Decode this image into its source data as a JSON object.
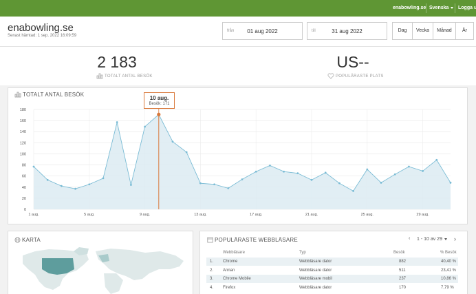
{
  "topbar": {
    "site": "enabowling.se",
    "language": "Svenska",
    "logout": "Logga ut"
  },
  "header": {
    "title": "enabowling.se",
    "fetched": "Senast hämtad: 1 sep. 2022 16:09:59",
    "from_label": "från",
    "from_value": "01 aug 2022",
    "to_label": "till",
    "to_value": "31 aug 2022",
    "periods": [
      "Dag",
      "Vecka",
      "Månad",
      "År"
    ]
  },
  "stats": {
    "total_visits_value": "2 183",
    "total_visits_label": "TOTALT ANTAL BESÖK",
    "popular_place_value": "US--",
    "popular_place_label": "POPULÄRASTE PLATS"
  },
  "visits_panel": {
    "title": "TOTALT ANTAL BESÖK",
    "tooltip_title": "10 aug.",
    "tooltip_value": "Besök: 171"
  },
  "chart_data": {
    "type": "area",
    "title": "TOTALT ANTAL BESÖK",
    "x": [
      1,
      2,
      3,
      4,
      5,
      6,
      7,
      8,
      9,
      10,
      11,
      12,
      13,
      14,
      15,
      16,
      17,
      18,
      19,
      20,
      21,
      22,
      23,
      24,
      25,
      26,
      27,
      28,
      29,
      30,
      31
    ],
    "x_tick_labels": [
      "1 aug.",
      "5 aug.",
      "9 aug.",
      "13 aug.",
      "17 aug.",
      "21 aug.",
      "25 aug.",
      "29 aug."
    ],
    "x_tick_positions": [
      1,
      5,
      9,
      13,
      17,
      21,
      25,
      29
    ],
    "series": [
      {
        "values": [
          77,
          53,
          42,
          37,
          45,
          56,
          157,
          44,
          149,
          171,
          122,
          103,
          47,
          45,
          38,
          54,
          68,
          79,
          68,
          65,
          53,
          66,
          47,
          33,
          72,
          48,
          63,
          77,
          69,
          89,
          48
        ],
        "color": "#7bbcd5"
      }
    ],
    "ylim": [
      0,
      180
    ],
    "y_ticks": [
      0,
      20,
      40,
      60,
      80,
      100,
      120,
      140,
      160,
      180
    ],
    "grid": true,
    "highlight": {
      "x": 10,
      "value": 171,
      "color": "#d9793c"
    }
  },
  "map_panel": {
    "title": "KARTA"
  },
  "browsers_panel": {
    "title": "POPULÄRASTE WEBBLÄSARE",
    "pager": "1 - 10 av 29",
    "columns": [
      "Webbläsare",
      "Typ",
      "Besök",
      "% Besök"
    ],
    "rows": [
      {
        "num": "1.",
        "name": "Chrome",
        "type": "Webbläsare dator",
        "visits": "882",
        "pct": "40,40 %"
      },
      {
        "num": "2.",
        "name": "Annan",
        "type": "Webbläsare dator",
        "visits": "511",
        "pct": "23,41 %"
      },
      {
        "num": "3.",
        "name": "Chrome Mobile",
        "type": "Webbläsare mobil",
        "visits": "237",
        "pct": "10,86 %"
      },
      {
        "num": "4.",
        "name": "Firefox",
        "type": "Webbläsare dator",
        "visits": "170",
        "pct": "7,79 %"
      }
    ]
  },
  "colors": {
    "topbar": "#5f9634",
    "accent": "#d9793c",
    "series": "#7bbcd5",
    "map_highlight": "#5e9d9d"
  }
}
